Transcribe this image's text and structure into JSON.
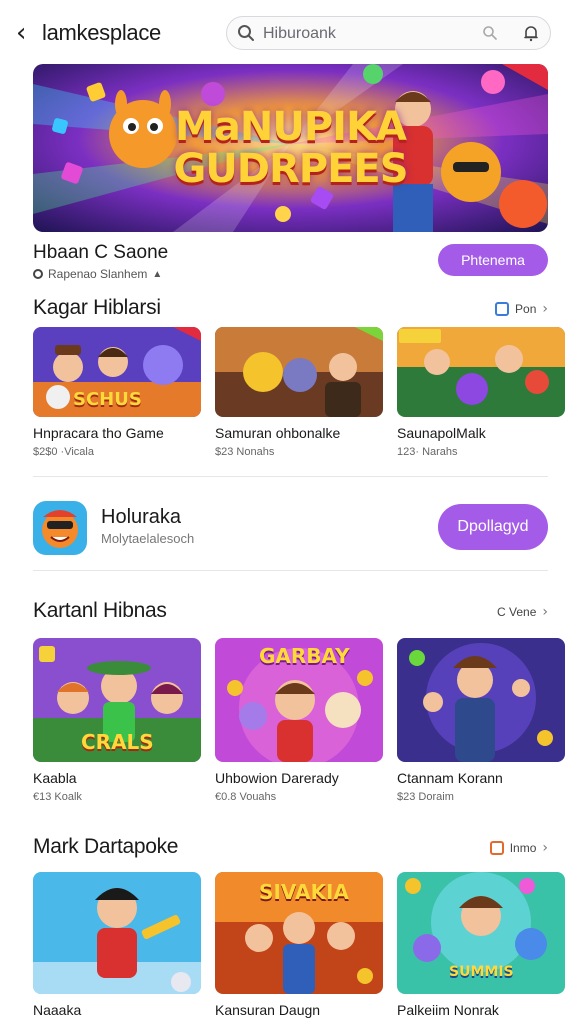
{
  "header": {
    "back_icon": "back-chevron-icon",
    "title": "lamkesplace",
    "search_placeholder": "Hiburoank"
  },
  "featured": {
    "banner_title_line1": "MaNUPIKA",
    "banner_title_line2": "GUDRPEES",
    "name": "Hbaan C Saone",
    "subtitle": "Rapenao Slanhem",
    "button_label": "Phtenema"
  },
  "sections": [
    {
      "title": "Kagar Hiblarsi",
      "see_more": "Pon",
      "cards": [
        {
          "name": "Hnpracara tho Game",
          "meta": "$2$0 ·Vicala"
        },
        {
          "name": "Samuran ohbonalke",
          "meta": "$23 Nonahs"
        },
        {
          "name": "SaunapolMalk",
          "meta": "123· Narahs"
        }
      ]
    },
    {
      "title": "Kartanl Hibnas",
      "see_more": "C Vene",
      "cards": [
        {
          "name": "Kaabla",
          "meta": "€13 Koalk"
        },
        {
          "name": "Uhbowion Darerady",
          "meta": "€0.8 Vouahs"
        },
        {
          "name": "Ctannam Korann",
          "meta": "$23 Doraim"
        }
      ]
    },
    {
      "title": "Mark Dartapoke",
      "see_more": "Inmo",
      "cards": [
        {
          "name": "Naaaka"
        },
        {
          "name": "Kansuran Daugn"
        },
        {
          "name": "Palkeiim Nonrak"
        }
      ]
    }
  ],
  "promo_app": {
    "name": "Holuraka",
    "subtitle": "Molytaelalesoch",
    "button_label": "Dpollagyd"
  },
  "thumb_texts": {
    "s1c1": "SCHUS",
    "s2c1": "CRALS",
    "s2c2": "GARBAY",
    "s3c2": "SIVAKIA",
    "s3c3": "SUMMIS"
  },
  "colors": {
    "accent_purple": "#a45ce8",
    "corner_red": "#e22b3e",
    "corner_green": "#7bd43a"
  }
}
